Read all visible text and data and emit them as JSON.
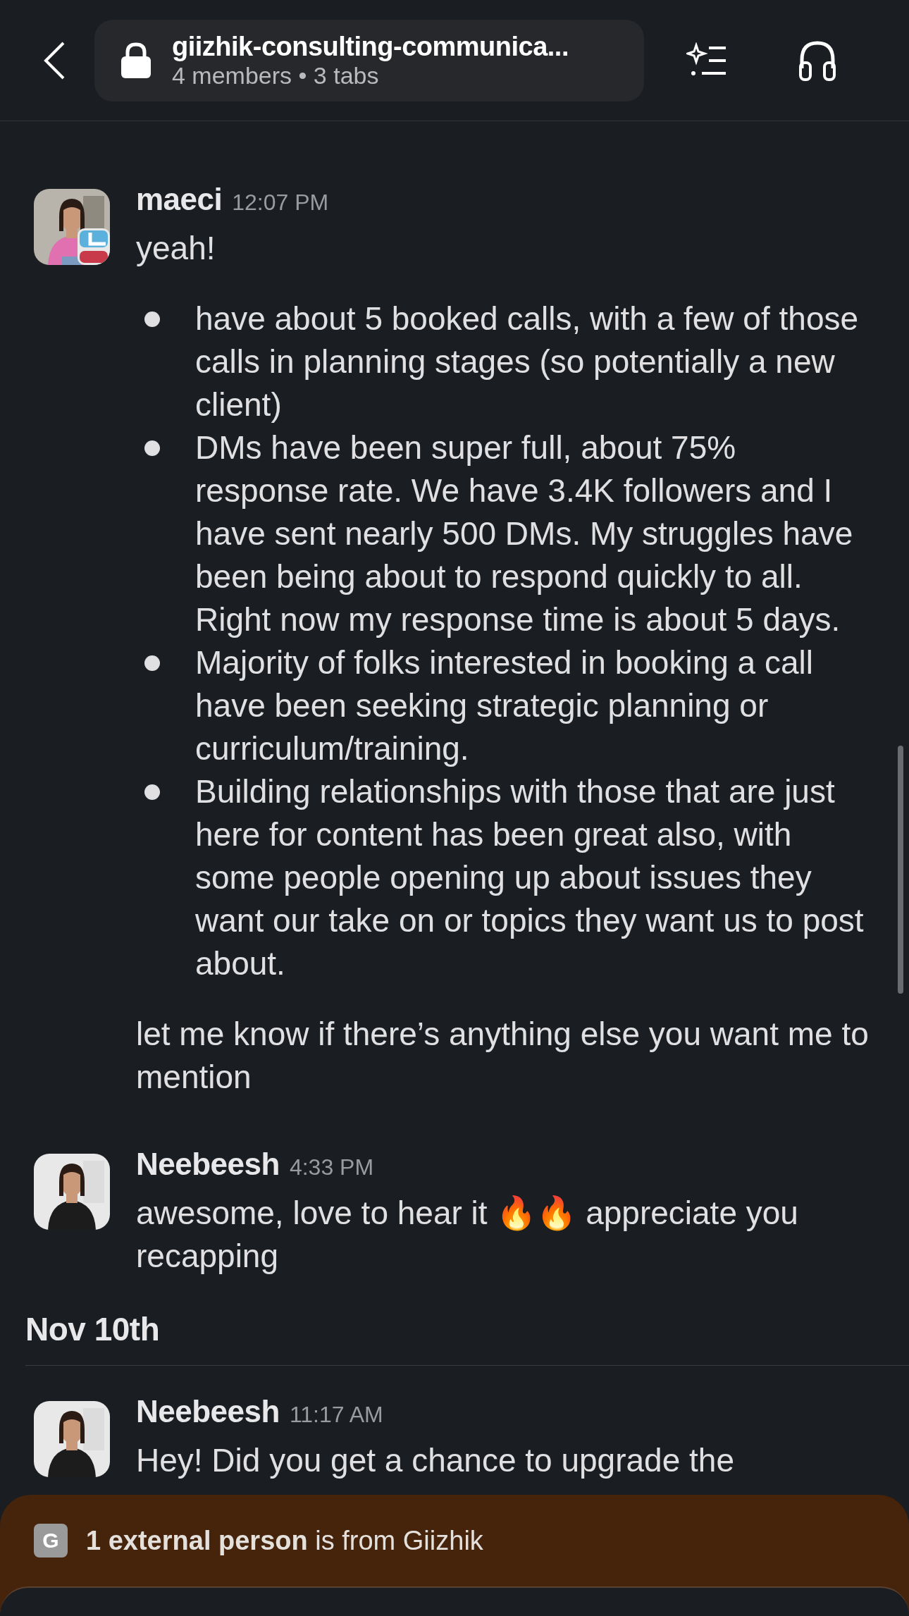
{
  "header": {
    "channel": "giizhik-consulting-communica...",
    "meta": "4 members • 3 tabs"
  },
  "messages": [
    {
      "kind": "message",
      "author": "maeci",
      "time": "12:07 PM",
      "status_icon": true,
      "paragraphs": [
        "yeah!"
      ],
      "bullets": [
        "have about 5 booked calls, with a few of those calls in planning stages (so potentially a new client)",
        "DMs have been super full, about 75% response rate. We have 3.4K followers and I have sent nearly 500 DMs. My struggles have been being about to respond quickly to all. Right now my response time is about 5 days.",
        "Majority of folks interested in booking a call have been seeking strategic planning or curriculum/training.",
        "Building relationships with those that are just here for content has been great also, with some people opening up about issues they want our take on or topics they want us to post about."
      ],
      "after": [
        "let me know if there’s anything else you want me to mention"
      ]
    },
    {
      "kind": "message",
      "author": "Neebeesh",
      "time": "4:33 PM",
      "status_icon": false,
      "paragraphs": [
        "awesome, love to hear it 🔥🔥 appreciate you recapping"
      ]
    },
    {
      "kind": "date",
      "label": "Nov 10th"
    },
    {
      "kind": "message",
      "author": "Neebeesh",
      "time": "11:17 AM",
      "status_icon": false,
      "paragraphs": [
        "Hey! Did you get a chance to upgrade the"
      ]
    }
  ],
  "banner": {
    "badge": "G",
    "text": "**1 external person** is from Giizhik"
  }
}
